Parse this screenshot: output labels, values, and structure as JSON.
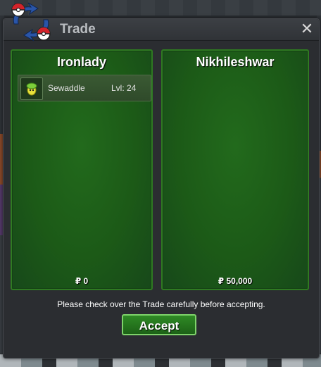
{
  "window": {
    "title": "Trade",
    "close_label": "✕"
  },
  "panels": [
    {
      "name": "Ironlady",
      "money": "₽ 0",
      "items": [
        {
          "name": "Sewaddle",
          "level": "Lvl: 24",
          "icon": "sewaddle-icon"
        }
      ]
    },
    {
      "name": "Nikhileshwar",
      "money": "₽ 50,000",
      "items": []
    }
  ],
  "notice": "Please check over the Trade carefully before accepting.",
  "accept_label": "Accept",
  "colors": {
    "panel_green": "#1c5a17",
    "button_green": "#2f8a25",
    "window_bg": "#2b2d31"
  }
}
